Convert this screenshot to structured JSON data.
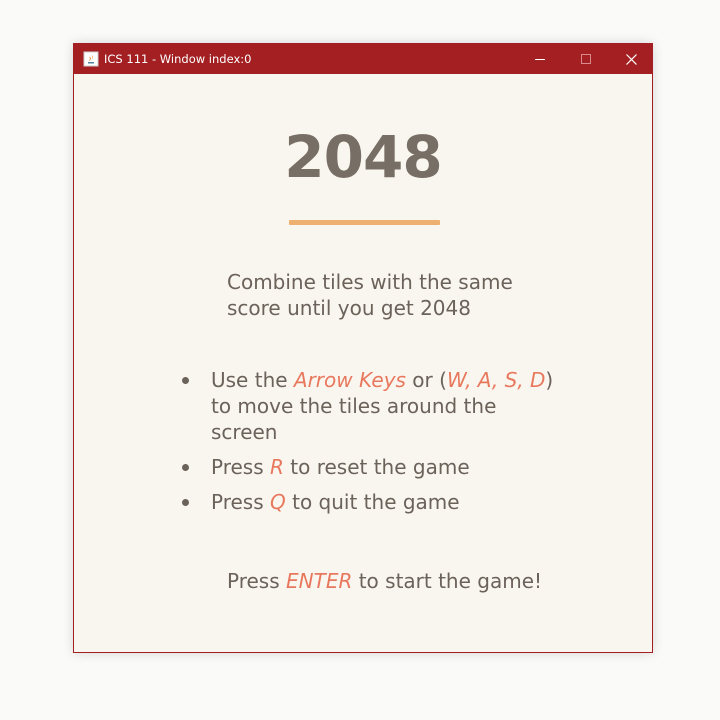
{
  "window": {
    "title": "ICS 111 - Window index:0",
    "colors": {
      "titlebar": "#a31f22",
      "background": "#f9f6ef",
      "text": "#6b625a",
      "title_text": "#776e65",
      "accent": "#e8785d",
      "divider": "#edb071"
    },
    "controls": {
      "minimize_icon": "minimize-icon",
      "maximize_icon": "maximize-icon",
      "close_icon": "close-icon"
    }
  },
  "game": {
    "title": "2048",
    "subtitle": "Combine tiles with the same score until you get 2048",
    "instructions": [
      {
        "before": "Use the ",
        "key1": "Arrow Keys",
        "middle": " or (",
        "key2": "W, A, S, D",
        "after": ") to move the tiles around the screen"
      },
      {
        "before": "Press ",
        "key": "R",
        "after": " to reset the game"
      },
      {
        "before": "Press ",
        "key": "Q",
        "after": " to quit the game"
      }
    ],
    "start": {
      "before": "Press ",
      "key": "ENTER",
      "after": " to start the game!"
    }
  }
}
